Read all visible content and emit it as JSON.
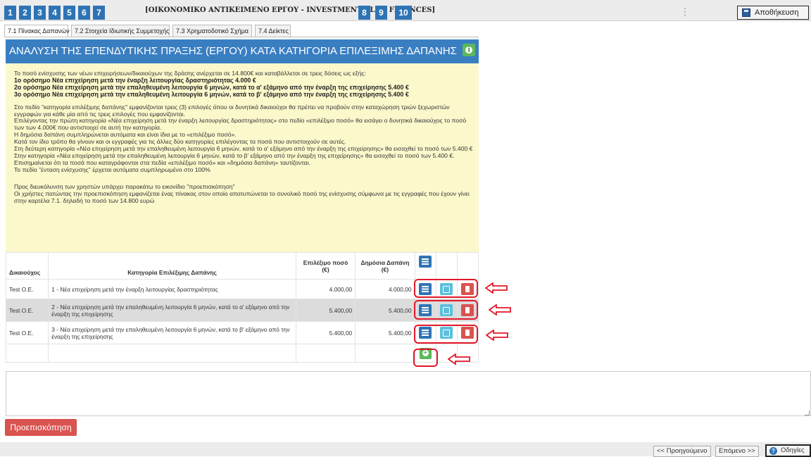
{
  "steps": [
    "1",
    "2",
    "3",
    "4",
    "5",
    "6",
    "7",
    "8",
    "9",
    "10"
  ],
  "current_step_title": "[ΟΙΚΟΝΟΜΙΚΟ ΑΝΤΙΚΕΙΜΕΝΟ ΕΡΓΟΥ - INVESTMENT PLAN FINANCES]",
  "toolbar": {
    "menu_dots": "⋮",
    "save_label": "Αποθήκευση"
  },
  "tabs": [
    {
      "label": "7.1 Πίνακας Δαπανών",
      "active": true
    },
    {
      "label": "7.2 Στοιχεία Ιδιωτικής Συμμετοχής",
      "active": false
    },
    {
      "label": "7.3 Χρηματοδοτικό Σχήμα",
      "active": false
    },
    {
      "label": "7.4 Δείκτες",
      "active": false
    }
  ],
  "section": {
    "title": "ΑΝΑΛΥΣΗ ΤΗΣ ΕΠΕΝΔΥΤΙΚΗΣ ΠΡΑΞΗΣ (ΕΡΓΟΥ) ΚΑΤΑ ΚΑΤΗΓΟΡΙΑ ΕΠΙΛΕΞΙΜΗΣ ΔΑΠΑΝΗΣ"
  },
  "instructions": {
    "intro": "Το ποσό ενίσχυσης των νέων επιχειρήσεων/δικαιούχων της δράσης ανέρχεται σε 14.800€ και καταβάλλεται σε τρεις δόσεις ως εξής:",
    "milestones": [
      "1ο ορόσημο Νέα επιχείρηση μετά την έναρξη λειτουργίας δραστηριότητας 4.000 €",
      "2ο ορόσημο Νέα επιχείρηση μετά την επαληθευμένη λειτουργία 6 μηνών, κατά το α' εξάμηνο από την έναρξη της επιχείρησης 5.400 €",
      "3ο ορόσημο Νέα επιχείρηση μετά την επαληθευμένη λειτουργία 6 μηνών, κατά το β' εξάμηνο από την έναρξη της επιχείρησης 5.400 €"
    ],
    "body": [
      "Στο πεδίο \"κατηγορία επιλέξιμης δαπάνης\" εμφανίζονται τρεις (3) επιλογές όπου οι δυνητικά δικαιούχοι θα πρέπει να προβούν στην καταχώρηση τριών ξεχωριστών εγγραφών για κάθε μία από τις τρεις επιλογές που εμφανίζονται.",
      "Επιλέγοντας την πρώτη κατηγορία «Νέα επιχείρηση μετά την έναρξη λειτουργίας δραστηριότητας» στο πεδίο «επιλέξιμο ποσό» θα εισάγει ο δυνητικά δικαιούχος το ποσό των των 4.000€ που αντιστοιχεί σε αυτή την κατηγορία.",
      "Η δημόσια δαπάνη συμπληρώνεται αυτόματα και είναι ίδια με το «επιλέξιμο ποσό».",
      "Κατά τον ίδιο τρόπο θα γίνουν και οι εγγραφές για τις άλλες δύο κατηγορίες επιλέγοντας τα ποσά που αντιστοιχούν σε αυτές.",
      "Στη δεύτερη κατηγορία «Νέα επιχείρηση μετά την επαληθευμένη λειτουργία 6 μηνών, κατά το α' εξάμηνο από την έναρξη της επιχείρησης» θα εισαχθεί το ποσό των 5.400 €",
      "Στην κατηγορία «Νέα επιχείρηση μετά την επαληθευμένη λειτουργία 6 μηνών, κατά το β' εξάμηνο από την έναρξη της επιχείρησης» θα εισαχθεί το ποσό των 5.400 €.",
      "Επισημαίνεται ότι τα ποσά που καταγράφονται στα πεδία «επιλέξιμο ποσό» και «δημόσια δαπάνη» ταυτίζονται.",
      "Το πεδίο \"ένταση ενίσχυσης\" έρχεται αυτόματα συμπληρωμένο στο 100%"
    ],
    "preview_note": [
      "Προς διευκόλυνση των χρηστών υπάρχει παρακάτω το εικονίδιο \"προεπισκόπηση\"",
      "Οι χρήστες πατώντας την προεπισκόπηση εμφανίζεται ένας πίνακας στον οποίο αποτυπώνεται το συνολικό ποσό της ενίσχυσης σύμφωνα με τις εγγραφές που έχουν γίνει στην καρτέλα 7.1. δηλαδή το ποσό των 14.800 ευρώ"
    ]
  },
  "table": {
    "headers": {
      "beneficiary": "Δικαιούχος",
      "category": "Κατηγορία Επιλέξιμης Δαπάνης",
      "eligible": "Επιλέξιμο ποσό (€)",
      "public": "Δημόσια Δαπάνη (€)"
    },
    "rows": [
      {
        "beneficiary": "Test O.E.",
        "category": "1 - Νέα επιχείρηση μετά την έναρξη λειτουργίας δραστηριότητας",
        "eligible": "4.000,00",
        "public": "4.000,00"
      },
      {
        "beneficiary": "Test O.E.",
        "category": "2 - Νέα επιχείρηση μετά την επαληθευμένη λειτουργία 6 μηνών, κατά το α' εξάμηνο από την έναρξη της επιχείρησης",
        "eligible": "5.400,00",
        "public": "5.400,00"
      },
      {
        "beneficiary": "Test O.E.",
        "category": "3 - Νέα επιχείρηση μετά την επαληθευμένη λειτουργία 6 μηνών, κατά το β' εξάμηνο από την έναρξη της επιχείρησης",
        "eligible": "5.400,00",
        "public": "5.400,00"
      }
    ]
  },
  "preview_button": "Προεπισκόπηση",
  "nav": {
    "prev": "<< Προηγούμενο",
    "next": "Επόμενο >>",
    "help": "Οδηγίες"
  },
  "colors": {
    "step_blue": "#2e74b5",
    "header_blue": "#3a7ec2",
    "instructions_bg": "#fbf8cc",
    "danger_red": "#d9534f",
    "success_green": "#5cb85c",
    "annotation_red": "#e3182a"
  }
}
